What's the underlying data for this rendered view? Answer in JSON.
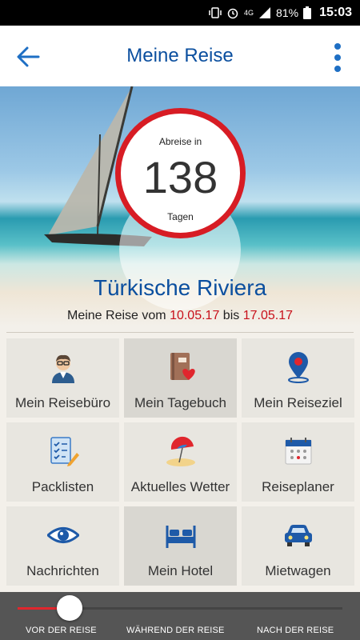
{
  "status_bar": {
    "battery": "81%",
    "time": "15:03",
    "network": "4G"
  },
  "header": {
    "title": "Meine Reise"
  },
  "hero": {
    "countdown": {
      "label_top": "Abreise in",
      "days": "138",
      "label_bottom": "Tagen"
    },
    "destination": "Türkische Riviera",
    "dates": {
      "prefix": "Meine Reise vom",
      "start": "10.05.17",
      "between": "bis",
      "end": "17.05.17"
    }
  },
  "tiles": [
    {
      "label": "Mein Reisebüro",
      "icon": "travel-agent-icon"
    },
    {
      "label": "Mein Tagebuch",
      "icon": "diary-icon"
    },
    {
      "label": "Mein Reiseziel",
      "icon": "map-pin-icon"
    },
    {
      "label": "Packlisten",
      "icon": "checklist-icon"
    },
    {
      "label": "Aktuelles Wetter",
      "icon": "beach-umbrella-icon"
    },
    {
      "label": "Reiseplaner",
      "icon": "calendar-icon"
    },
    {
      "label": "Nachrichten",
      "icon": "eye-icon"
    },
    {
      "label": "Mein Hotel",
      "icon": "bed-icon"
    },
    {
      "label": "Mietwagen",
      "icon": "car-icon"
    }
  ],
  "trip_phase": {
    "labels": [
      "VOR DER REISE",
      "WÄHREND DER REISE",
      "NACH DER REISE"
    ],
    "progress": 0.16
  },
  "colors": {
    "brand_blue": "#0b4f9f",
    "accent_red": "#d71c24"
  }
}
